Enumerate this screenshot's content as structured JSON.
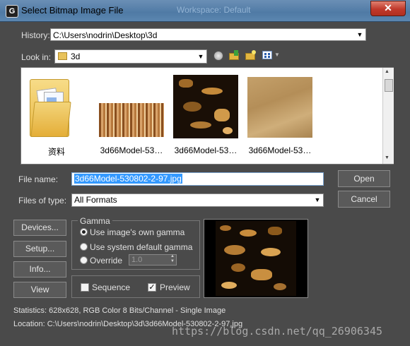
{
  "window": {
    "title": "Select Bitmap Image File",
    "background_title": "Workspace: Default",
    "close_glyph": "✕"
  },
  "history": {
    "label": "History:",
    "value": "C:\\Users\\nodrin\\Desktop\\3d"
  },
  "lookin": {
    "label": "Look in:",
    "value": "3d"
  },
  "files": [
    {
      "name": "资料",
      "type": "folder"
    },
    {
      "name": "3d66Model-53…",
      "type": "image"
    },
    {
      "name": "3d66Model-53…",
      "type": "image"
    },
    {
      "name": "3d66Model-53…",
      "type": "image"
    }
  ],
  "filename": {
    "label": "File name:",
    "value": "3d66Model-530802-2-97.jpg"
  },
  "filetype": {
    "label": "Files of type:",
    "value": "All Formats"
  },
  "buttons": {
    "open": "Open",
    "cancel": "Cancel",
    "devices": "Devices...",
    "setup": "Setup...",
    "info": "Info...",
    "view": "View"
  },
  "gamma": {
    "title": "Gamma",
    "options": [
      "Use image's own gamma",
      "Use system default gamma",
      "Override"
    ],
    "selected_index": 0,
    "override_value": "1.0"
  },
  "sequence": {
    "label": "Sequence",
    "checked": false
  },
  "preview_toggle": {
    "label": "Preview",
    "checked": true
  },
  "statistics": "Statistics:  628x628, RGB Color 8 Bits/Channel - Single Image",
  "location": "Location:  C:\\Users\\nodrin\\Desktop\\3d\\3d66Model-530802-2-97.jpg",
  "watermark": "https://blog.csdn.net/qq_26906345",
  "colors": {
    "selection": "#3399ff",
    "titlebar": "#5b86b0",
    "panel": "#464646"
  }
}
